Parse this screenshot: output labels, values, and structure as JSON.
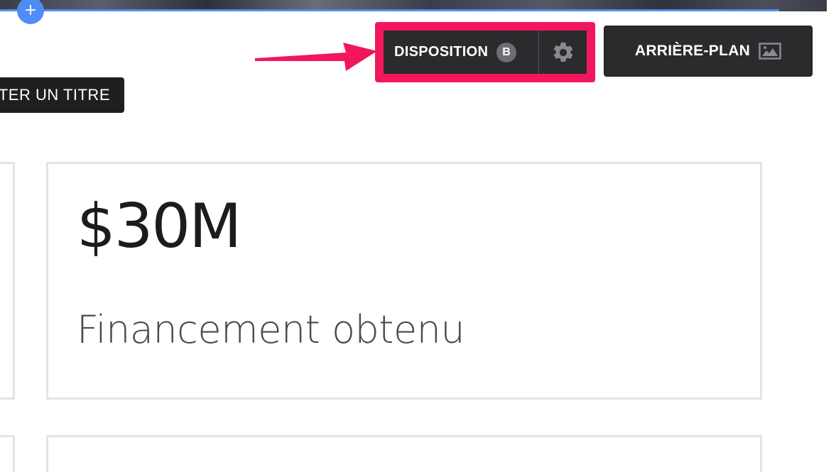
{
  "toolbar": {
    "add_section_symbol": "+",
    "layout_label": "DISPOSITION",
    "layout_badge": "B",
    "background_label": "ARRIÈRE-PLAN",
    "add_title_label": "TER UN TITRE"
  },
  "stats": [
    {
      "value": "$30M",
      "label": "Financement obtenu"
    }
  ],
  "colors": {
    "accent_blue": "#4f8cf5",
    "highlight_pink": "#f2175c",
    "button_dark": "#2b2b2e"
  },
  "icons": {
    "add": "plus-icon",
    "settings": "gear-icon",
    "background": "image-icon",
    "annotation": "arrow-icon"
  }
}
